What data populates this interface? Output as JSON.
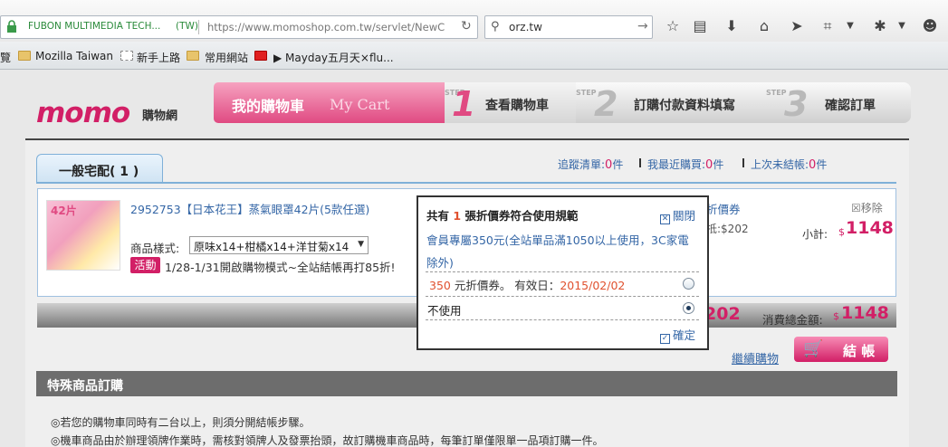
{
  "browser": {
    "site_label": "FUBON MULTIMEDIA TECH...",
    "site_country": "(TW)",
    "url": "https://www.momoshop.com.tw/servlet/NewC",
    "search_query": "orz.tw",
    "bookmarks": [
      "覽",
      "Mozilla Taiwan",
      "新手上路",
      "常用網站",
      "▶ Mayday五月天×flu..."
    ]
  },
  "header": {
    "logo": "momo",
    "logo_sub": "購物網",
    "cart_tab_cn": "我的購物車",
    "cart_tab_en": "My Cart",
    "steps": [
      {
        "label": "STEP",
        "num": "1",
        "text": "查看購物車"
      },
      {
        "label": "STEP",
        "num": "2",
        "text": "訂購付款資料填寫"
      },
      {
        "label": "STEP",
        "num": "3",
        "text": "確認訂單"
      }
    ]
  },
  "cart": {
    "tab_label": "一般宅配( 1 )",
    "links": [
      {
        "label": "追蹤清單:",
        "count": "0",
        "unit": "件"
      },
      {
        "label": "我最近購買:",
        "count": "0",
        "unit": "件"
      },
      {
        "label": "上次未結帳:",
        "count": "0",
        "unit": "件"
      }
    ],
    "item": {
      "image_tag": "42片",
      "name": "2952753【日本花王】蒸氣眼罩42片(5款任選)",
      "style_label": "商品樣式:",
      "style_value": "原味x14+柑橘x14+洋甘菊x14",
      "promo_badge": "活動",
      "promo_text": "1/28-1/31開啟購物模式~全站結帳再打85折!",
      "coupon_link_partial": "折價券",
      "discount_partial": "抵:$202",
      "remove": "☒移除",
      "subtotal_label": "小計:",
      "currency": "$",
      "subtotal": "1148"
    },
    "total_partial": "202",
    "total_label": "消費總金額:",
    "total": "1148",
    "continue_label": "繼續購物",
    "checkout_label": "結 帳"
  },
  "special": {
    "title": "特殊商品訂購",
    "notes": [
      "◎若您的購物車同時有二台以上，則須分開結帳步驟。",
      "◎機車商品由於辦理領牌作業時，需核對領牌人及發票抬頭，故訂購機車商品時，每筆訂單僅限單一品項訂購一件。"
    ]
  },
  "popup": {
    "title_pre": "共有 ",
    "title_count": "1",
    "title_post": " 張折價券符合使用規範",
    "close_label": "關閉",
    "desc": "會員專屬350元(全站單品滿1050以上使用，3C家電除外)",
    "coupon_amount": "350",
    "coupon_text": " 元折價券。 有效日：",
    "coupon_date": "2015/02/02",
    "no_use": "不使用",
    "confirm_label": "確定"
  }
}
